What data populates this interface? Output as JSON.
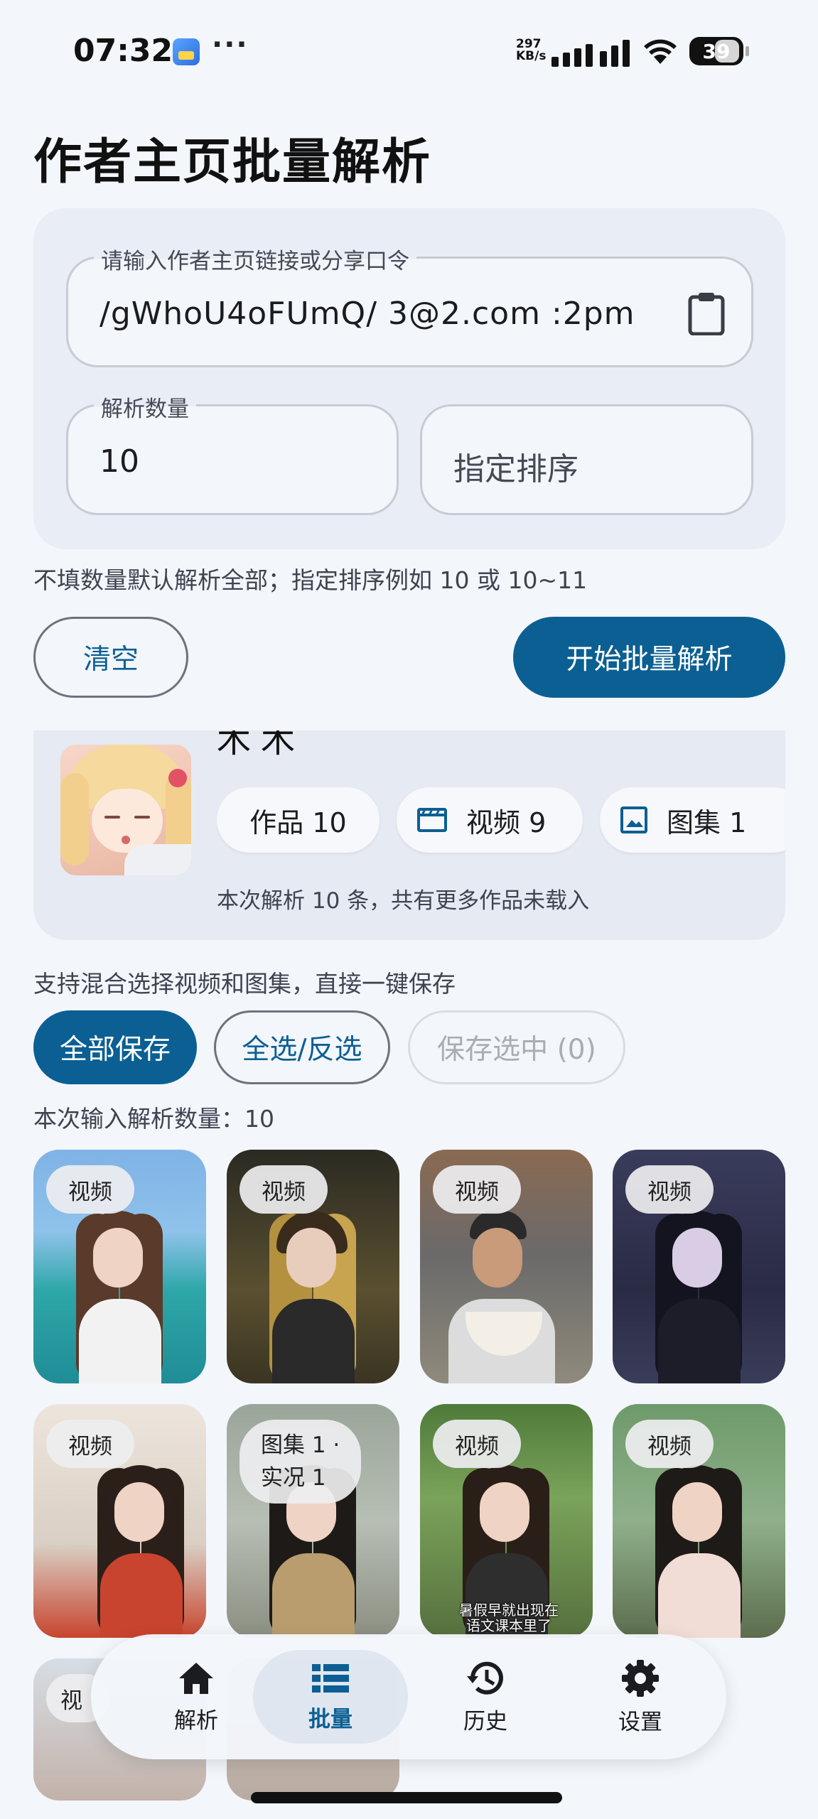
{
  "status_bar": {
    "time": "07:32",
    "dots": "···",
    "net_speed_value": "297",
    "net_speed_unit": "KB/s",
    "battery": "39",
    "icons": [
      "app-notification-icon",
      "signal-icon",
      "wifi-icon",
      "battery-icon"
    ]
  },
  "page": {
    "title": "作者主页批量解析"
  },
  "form": {
    "link_label": "请输入作者主页链接或分享口令",
    "link_value": "/gWhoU4oFUmQ/ 3@2.com :2pm",
    "count_label": "解析数量",
    "count_value": "10",
    "order_placeholder": "指定排序",
    "hint": "不填数量默认解析全部；指定排序例如 10 或 10~11",
    "clear_label": "清空",
    "start_label": "开始批量解析"
  },
  "profile": {
    "name": "木木",
    "works_label": "作品 10",
    "videos_label": "视频 9",
    "gallery_label": "图集 1",
    "note": "本次解析 10 条，共有更多作品未载入"
  },
  "selection": {
    "hint": "支持混合选择视频和图集，直接一键保存",
    "save_all_label": "全部保存",
    "toggle_label": "全选/反选",
    "save_selected_label": "保存选中 (0)",
    "parse_count_text": "本次输入解析数量：10"
  },
  "grid": {
    "items": [
      {
        "badge": "视频"
      },
      {
        "badge": "视频"
      },
      {
        "badge": "视频"
      },
      {
        "badge": "视频"
      },
      {
        "badge": "视频"
      },
      {
        "badge_line1": "图集 1 ·",
        "badge_line2": "实况 1"
      },
      {
        "badge": "视频",
        "caption_line1": "暑假早就出现在",
        "caption_line2": "语文课本里了"
      },
      {
        "badge": "视频"
      },
      {
        "badge": "视"
      },
      {
        "badge": ""
      }
    ]
  },
  "nav": {
    "items": [
      {
        "label": "解析",
        "icon": "home-icon"
      },
      {
        "label": "批量",
        "icon": "list-icon",
        "active": true
      },
      {
        "label": "历史",
        "icon": "history-icon"
      },
      {
        "label": "设置",
        "icon": "gear-icon"
      }
    ]
  },
  "colors": {
    "accent": "#0b5f93",
    "background": "#f3f6fb",
    "card": "#e9edf5"
  }
}
